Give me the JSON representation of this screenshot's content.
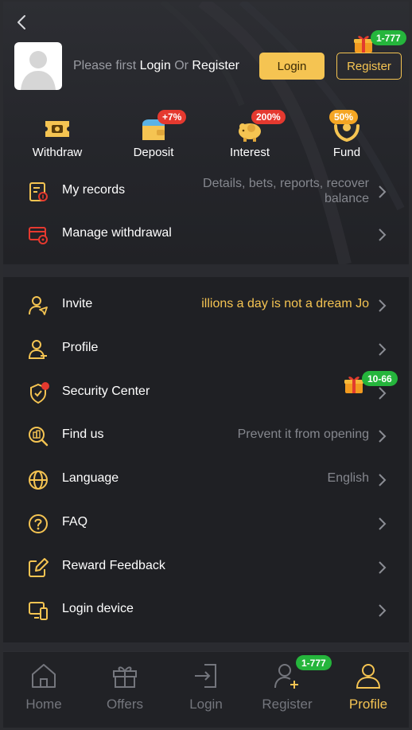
{
  "header": {
    "prompt_prefix": "Please first ",
    "prompt_login": "Login",
    "prompt_or": " Or ",
    "prompt_register": "Register",
    "login_button": "Login",
    "register_button": "Register",
    "register_gift_badge": "1-777"
  },
  "quick_actions": [
    {
      "label": "Withdraw",
      "icon": "ticket-icon",
      "badge": ""
    },
    {
      "label": "Deposit",
      "icon": "wallet-icon",
      "badge": "+7%"
    },
    {
      "label": "Interest",
      "icon": "piggy-bank-icon",
      "badge": "200%"
    },
    {
      "label": "Fund",
      "icon": "hands-coin-icon",
      "badge": "50%"
    }
  ],
  "menu": {
    "my_records": {
      "label": "My records",
      "hint_line1": "Details, bets, reports, recover",
      "hint_line2": "balance"
    },
    "manage_withdrawal": {
      "label": "Manage withdrawal"
    },
    "invite": {
      "label": "Invite",
      "hint": "illions a day is not a dream  Jo"
    },
    "profile": {
      "label": "Profile"
    },
    "security_center": {
      "label": "Security Center",
      "gift_badge": "10-66"
    },
    "find_us": {
      "label": "Find us",
      "hint": "Prevent it from opening"
    },
    "language": {
      "label": "Language",
      "hint": "English"
    },
    "faq": {
      "label": "FAQ"
    },
    "reward_feedback": {
      "label": "Reward Feedback"
    },
    "login_device": {
      "label": "Login device"
    }
  },
  "tabbar": {
    "home": "Home",
    "offers": "Offers",
    "login": "Login",
    "register": "Register",
    "register_badge": "1-777",
    "profile": "Profile"
  },
  "colors": {
    "accent": "#f5c452",
    "background": "#1f2024",
    "badge_green": "#25b53c",
    "badge_red": "#e5392f"
  }
}
